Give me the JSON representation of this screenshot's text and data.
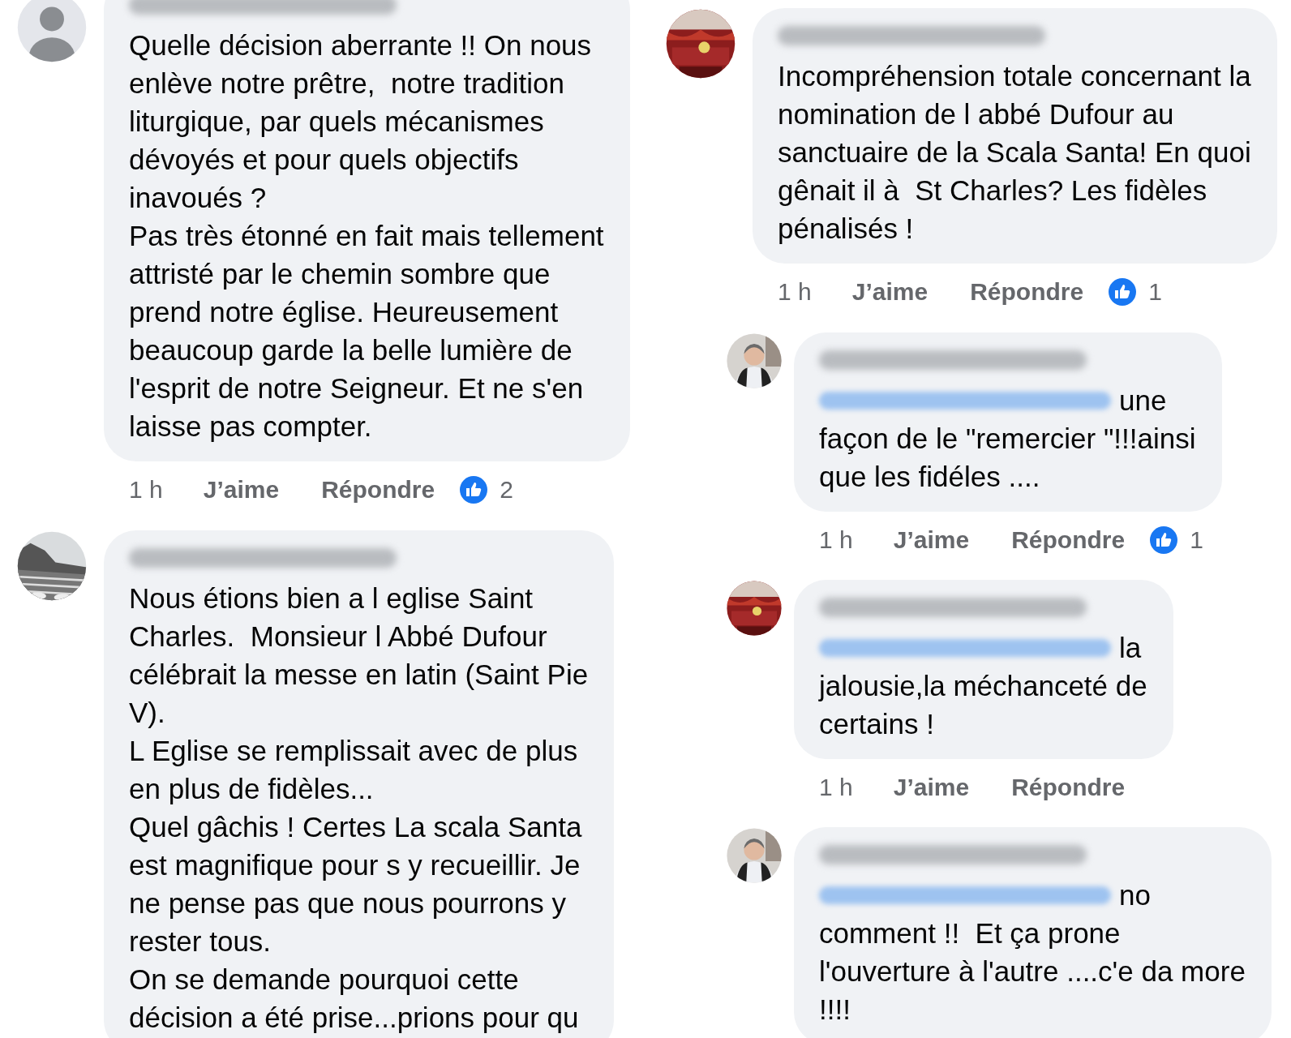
{
  "columns": [
    {
      "comments": [
        {
          "avatar": {
            "kind": "silhouette"
          },
          "name_blurred": true,
          "text": "Quelle décision aberrante !! On nous\nenlève notre prêtre,  notre tradition\nliturgique, par quels mécanismes\ndévoyés et pour quels objectifs\ninavoués ?\nPas très étonné en fait mais tellement\nattristé par le chemin sombre que\nprend notre église. Heureusement\nbeaucoup garde la belle lumière de\nl'esprit de notre Seigneur. Et ne s'en\nlaisse pas compter.",
          "actions": {
            "time": "1 h",
            "like": "J’aime",
            "reply": "Répondre",
            "reactions": "2"
          }
        },
        {
          "avatar": {
            "kind": "landscape"
          },
          "name_blurred": true,
          "text": "Nous étions bien a l eglise Saint\nCharles.  Monsieur l Abbé Dufour\ncélébrait la messe en latin (Saint Pie\nV).\nL Eglise se remplissait avec de plus\nen plus de fidèles...\nQuel gâchis ! Certes La scala Santa\nest magnifique pour s y recueillir. Je\nne pense pas que nous pourrons y\nrester tous.\nOn se demande pourquoi cette\ndécision a été prise...prions pour qu"
        }
      ]
    },
    {
      "comments": [
        {
          "avatar": {
            "kind": "interior"
          },
          "name_blurred": true,
          "text": "Incompréhension totale concernant la\nnomination de l abbé Dufour au\nsanctuaire de la Scala Santa! En quoi\ngênait il à  St Charles? Les fidèles\npénalisés !",
          "actions": {
            "time": "1 h",
            "like": "J’aime",
            "reply": "Répondre",
            "reactions": "1"
          },
          "replies": [
            {
              "avatar": {
                "kind": "person"
              },
              "name_blurred": true,
              "mention_blurred": true,
              "lead": "une",
              "text": "façon de le \"remercier \"!!!ainsi\nque les fidéles ....",
              "actions": {
                "time": "1 h",
                "like": "J’aime",
                "reply": "Répondre",
                "reactions": "1"
              }
            },
            {
              "avatar": {
                "kind": "interior"
              },
              "name_blurred": true,
              "mention_blurred": true,
              "lead": "la",
              "text": "jalousie,la méchanceté de\ncertains !",
              "actions": {
                "time": "1 h",
                "like": "J’aime",
                "reply": "Répondre"
              }
            },
            {
              "avatar": {
                "kind": "person"
              },
              "name_blurred": true,
              "mention_blurred": true,
              "lead": "no",
              "text": "comment !!  Et ça prone\nl'ouverture à l'autre ....c'e da more\n!!!!"
            }
          ]
        }
      ]
    }
  ]
}
